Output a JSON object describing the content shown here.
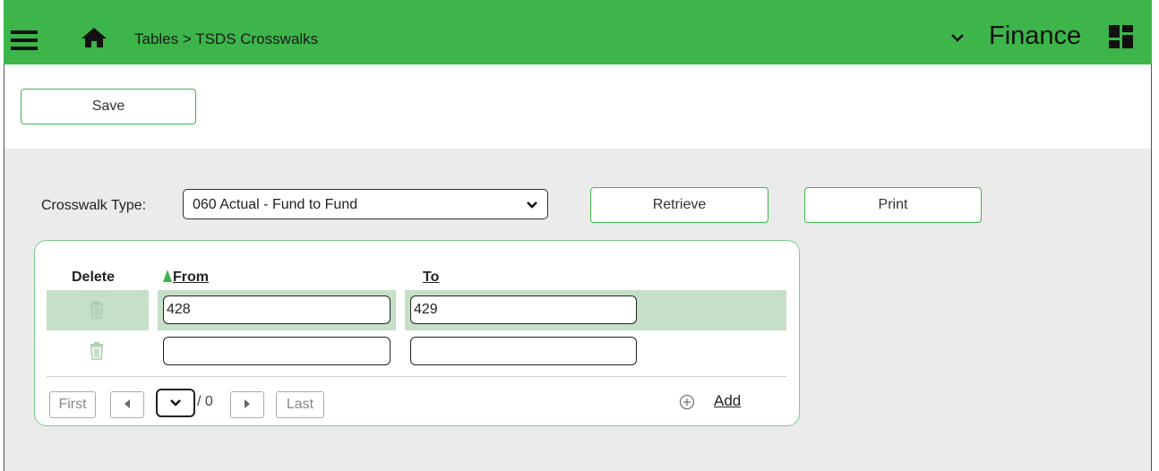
{
  "header": {
    "breadcrumb": "Tables > TSDS Crosswalks",
    "module": "Finance",
    "menu_icon": "hamburger-menu-icon",
    "home_icon": "home-icon",
    "module_dropdown_icon": "chevron-down-icon",
    "apps_icon": "dashboard-grid-icon",
    "bg_color": "#3db54a"
  },
  "toolbar": {
    "save_label": "Save"
  },
  "filters": {
    "crosswalk_type_label": "Crosswalk Type:",
    "crosswalk_type_value": "060 Actual - Fund to Fund",
    "retrieve_label": "Retrieve",
    "print_label": "Print"
  },
  "grid": {
    "columns": {
      "delete": "Delete",
      "from": "From",
      "to": "To"
    },
    "rows": [
      {
        "from": "428",
        "to": "429",
        "highlighted": true
      },
      {
        "from": "",
        "to": "",
        "highlighted": false
      }
    ],
    "pager": {
      "first": "First",
      "prev_icon": "triangle-left-icon",
      "page_selected": "",
      "page_total": "/ 0",
      "next_icon": "triangle-right-icon",
      "last": "Last"
    },
    "add_label": "Add",
    "add_icon": "plus-circle-icon"
  },
  "colors": {
    "accent": "#3db54a",
    "row_highlight": "#c5dfc8",
    "content_bg": "#ebebeb"
  }
}
